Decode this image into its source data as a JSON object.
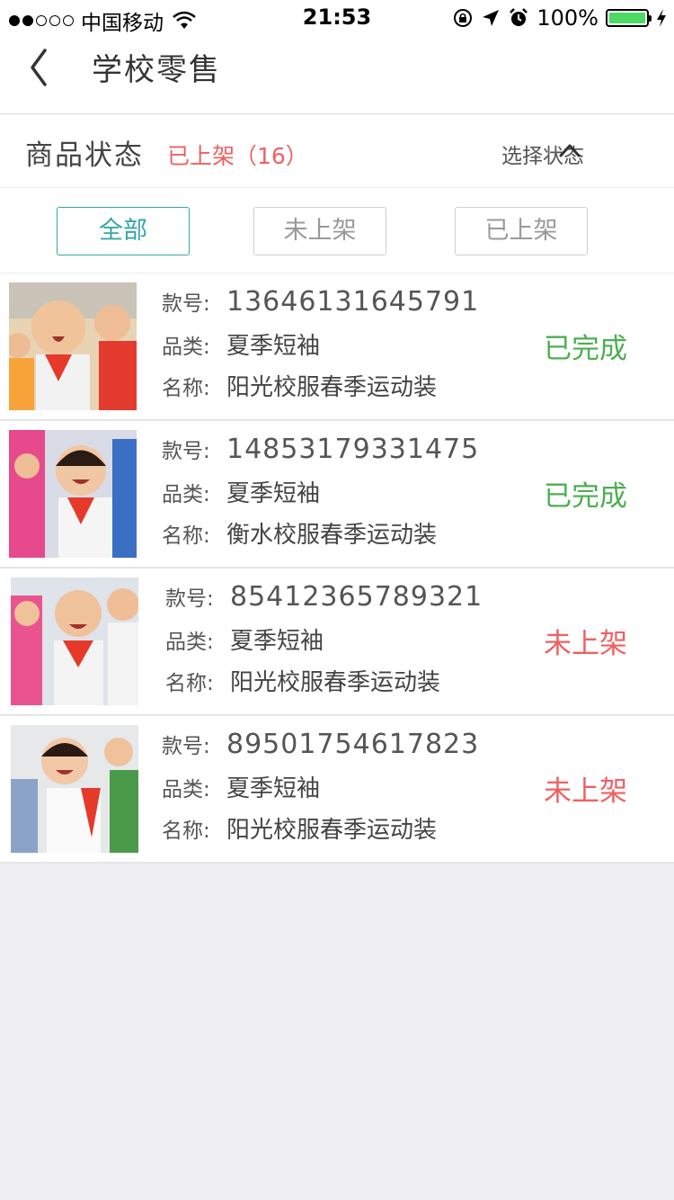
{
  "statusbar": {
    "carrier": "中国移动",
    "time": "21:53",
    "battery": "100%"
  },
  "nav": {
    "title": "学校零售"
  },
  "filter": {
    "label": "商品状态",
    "current_status": "已上架（16）",
    "select_label": "选择状态"
  },
  "tabs": [
    {
      "label": "全部",
      "active": true
    },
    {
      "label": "未上架",
      "active": false
    },
    {
      "label": "已上架",
      "active": false
    }
  ],
  "field_labels": {
    "code": "款号:",
    "category": "品类:",
    "name": "名称:"
  },
  "products": [
    {
      "code": "13646131645791",
      "category": "夏季短袖",
      "name": "阳光校服春季运动装",
      "status": "已完成"
    },
    {
      "code": "14853179331475",
      "category": "夏季短袖",
      "name": "衡水校服春季运动装",
      "status": "已完成"
    },
    {
      "code": "85412365789321",
      "category": "夏季短袖",
      "name": "阳光校服春季运动装",
      "status": "未上架"
    },
    {
      "code": "89501754617823",
      "category": "夏季短袖",
      "name": "阳光校服春季运动装",
      "status": "未上架"
    }
  ],
  "colors": {
    "accent": "#35a7a5",
    "status_done": "#4caf50",
    "status_off": "#f06060"
  }
}
